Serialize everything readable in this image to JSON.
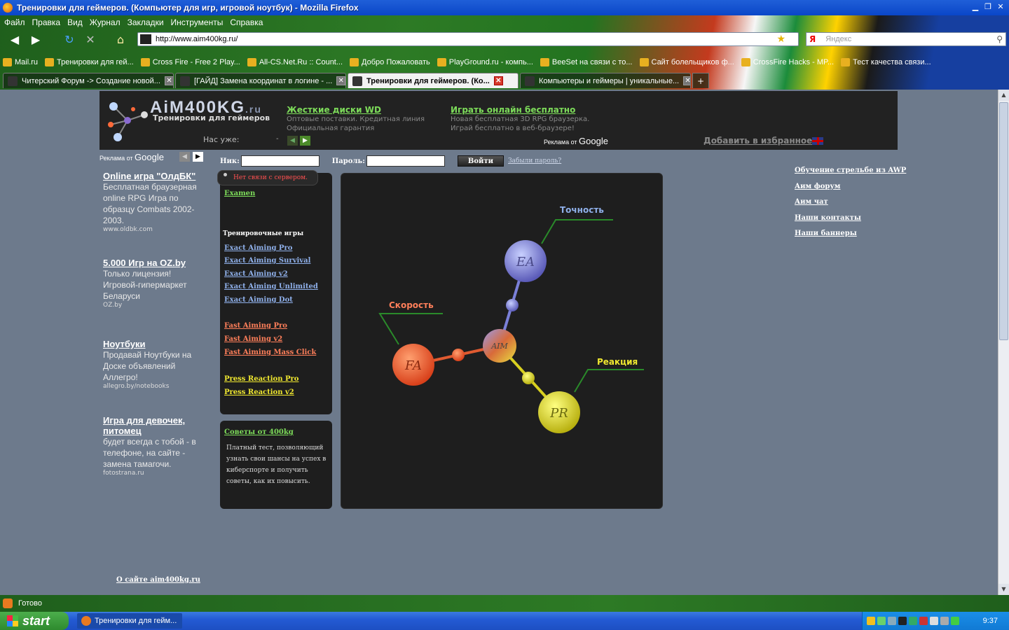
{
  "window": {
    "title": "Тренировки для геймеров. (Компьютер для игр, игровой ноутбук) - Mozilla Firefox"
  },
  "menu": [
    "Файл",
    "Правка",
    "Вид",
    "Журнал",
    "Закладки",
    "Инструменты",
    "Справка"
  ],
  "nav": {
    "url": "http://www.aim400kg.ru/",
    "search_placeholder": "Яндекс",
    "search_engine_icon": "Я"
  },
  "bookmarks": [
    "Mail.ru",
    "Тренировки для гей...",
    "Cross Fire - Free 2 Play...",
    "All-CS.Net.Ru :: Count...",
    "Добро Пожаловать",
    "PlayGround.ru - компь...",
    "BeeSet на связи с то...",
    "Сайт болельщиков ф...",
    "CrossFire Hacks - MP...",
    "Тест качества связи..."
  ],
  "tabs": [
    {
      "label": "Читерский Форум -> Создание новой...",
      "active": false
    },
    {
      "label": "[ГАЙД] Замена координат в логине - ...",
      "active": false
    },
    {
      "label": "Тренировки для геймеров. (Ко...",
      "active": true
    },
    {
      "label": "Компьютеры и геймеры | уникальные...",
      "active": false
    }
  ],
  "header": {
    "brand": "AiM400KG",
    "brand_suffix": ".ru",
    "subtitle": "Тренировки для геймеров",
    "count_label": "Нас уже:",
    "count_value": "-",
    "ad1_title": "Жесткие диски WD",
    "ad1_desc": "Оптовые поставки. Кредитная линия Официальная гарантия",
    "ad2_title": "Играть онлайн бесплатно",
    "ad2_desc": "Новая бесплатная 3D RPG браузерка. Играй бесплатно в веб-браузере!",
    "ads_by": "Реклама от",
    "google": "Google",
    "favorite": "Добавить в избранное"
  },
  "left_ads": {
    "ads_by": "Реклама от",
    "google": "Google",
    "items": [
      {
        "title": "Online игра \"ОлдБК\"",
        "desc": "Бесплатная браузерная online RPG Игра по образцу Combats 2002-2003.",
        "url": "www.oldbk.com"
      },
      {
        "title": "5.000 Игр на OZ.by",
        "desc": "Только лицензия! Игровой-гипермаркет Беларуси",
        "url": "OZ.by"
      },
      {
        "title": "Ноутбуки",
        "desc": "Продавай Ноутбуки на Доске объявлений Аллегро!",
        "url": "allegro.by/notebooks"
      },
      {
        "title": "Игра для девочек, питомец",
        "desc": "будет всегда с тобой - в телефоне, на сайте - замена тамагочи.",
        "url": "fotostrana.ru"
      }
    ]
  },
  "login": {
    "nick_label": "Ник:",
    "pass_label": "Пароль:",
    "submit": "Войти",
    "forgot": "Забыли пароль?"
  },
  "games": {
    "status": "Нет связи с сервером.",
    "examen": "Examen",
    "heading": "Тренировочные игры",
    "ea": [
      "Exact Aiming Pro",
      "Exact Aiming Survival",
      "Exact Aiming v2",
      "Exact Aiming Unlimited",
      "Exact Aiming Dot"
    ],
    "fa": [
      "Fast Aiming Pro",
      "Fast Aiming v2",
      "Fast Aiming Mass Click"
    ],
    "pr": [
      "Press Reaction Pro",
      "Press Reaction v2"
    ]
  },
  "tips": {
    "title": "Советы от 400kg",
    "desc": "Платный тест, позволяющий узнать свои шансы на успех в киберспорте и получить советы, как их повысить."
  },
  "diagram": {
    "labels": {
      "accuracy": "Точность",
      "speed": "Скорость",
      "reaction": "Реакция"
    },
    "nodes": {
      "center": "AIM",
      "ea": "EA",
      "fa": "FA",
      "pr": "PR"
    },
    "colors": {
      "accuracy": "#8fb0ea",
      "speed": "#ff7f5a",
      "reaction": "#f0e830"
    }
  },
  "right_links": [
    "Обучение стрельбе из AWP",
    "Аим форум",
    "Аим чат",
    "Наши контакты",
    "Наши баннеры"
  ],
  "footer": {
    "about": "О сайте aim400kg.ru",
    "extra": "...."
  },
  "status_bar": "Готово",
  "taskbar": {
    "start": "start",
    "task": "Тренировки для гейм...",
    "clock": "9:37"
  }
}
